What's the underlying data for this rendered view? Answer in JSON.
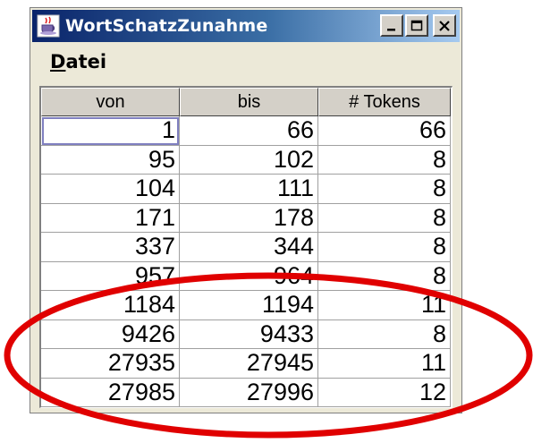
{
  "window": {
    "title": "WortSchatzZunahme",
    "icon": "java-cup-icon",
    "buttons": [
      "minimize",
      "maximize",
      "close"
    ]
  },
  "menu": {
    "items": [
      {
        "label": "Datei",
        "mnemonic": "D"
      }
    ]
  },
  "table": {
    "columns": [
      "von",
      "bis",
      "# Tokens"
    ],
    "rows": [
      [
        "1",
        "66",
        "66"
      ],
      [
        "95",
        "102",
        "8"
      ],
      [
        "104",
        "111",
        "8"
      ],
      [
        "171",
        "178",
        "8"
      ],
      [
        "337",
        "344",
        "8"
      ],
      [
        "957",
        "964",
        "8"
      ],
      [
        "1184",
        "1194",
        "11"
      ],
      [
        "9426",
        "9433",
        "8"
      ],
      [
        "27935",
        "27945",
        "11"
      ],
      [
        "27985",
        "27996",
        "12"
      ]
    ]
  },
  "annotation": {
    "shape": "ellipse",
    "color": "#e00000"
  }
}
